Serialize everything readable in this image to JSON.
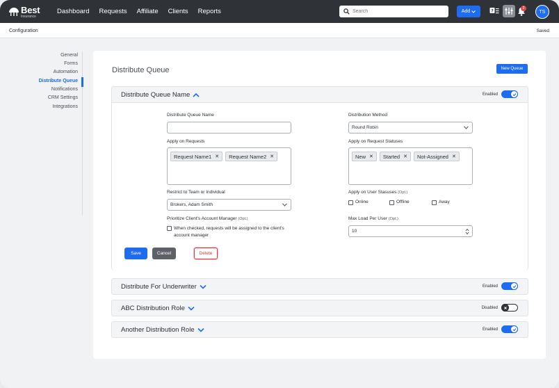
{
  "app": {
    "logo_name": "Best",
    "logo_sub": "Insurance",
    "nav": [
      "Dashboard",
      "Requests",
      "Affiliate",
      "Clients",
      "Reports"
    ],
    "search_placeholder": "Search",
    "add_label": "Add",
    "notification_count": "2",
    "avatar_initials": "TS"
  },
  "subbar": {
    "breadcrumb": "Configuration",
    "status": "Saved"
  },
  "sidenav": {
    "items": [
      "General",
      "Forms",
      "Automation",
      "Distribute Queue",
      "Notifications",
      "CRM Settings",
      "Integrations"
    ],
    "active": "Distribute Queue"
  },
  "main": {
    "title": "Distribute Queue",
    "new_queue_label": "New Queue",
    "sections": [
      {
        "title": "Distribute Queue Name",
        "expanded": true,
        "status": "Enabled",
        "enabled": true
      },
      {
        "title": "Distribute For Underwriter",
        "expanded": false,
        "status": "Enabled",
        "enabled": true
      },
      {
        "title": "ABC Distribution Role",
        "expanded": false,
        "status": "Disabled",
        "enabled": false
      },
      {
        "title": "Another Distribution Role",
        "expanded": false,
        "status": "Enabled",
        "enabled": true
      }
    ]
  },
  "form": {
    "queue_name_label": "Distribute Queue Name",
    "queue_name_value": "",
    "apply_requests_label": "Apply on Requests",
    "requests": [
      "Request Name1",
      "Request Name2"
    ],
    "restrict_label": "Restrict to Team or Individual",
    "restrict_value": "Brokers, Adam Smith",
    "prioritize_label": "Prioritize Client's Account Manager",
    "opt_tag": "(Opt.)",
    "prioritize_check": "When checked, requests will be assigned to the client's account manager",
    "method_label": "Distribution Method",
    "method_value": "Round Robin",
    "apply_statuses_label": "Apply on Request Statuses",
    "statuses": [
      "New",
      "Started",
      "Not-Assigned"
    ],
    "user_statuses_label": "Apply on User Stasuses",
    "user_statuses": [
      "Online",
      "Offline",
      "Away"
    ],
    "max_load_label": "Max Load Per User",
    "max_load_value": "10",
    "save_label": "Save",
    "cancel_label": "Cancel",
    "delete_label": "Delete"
  },
  "colors": {
    "accent": "#1e6cf0",
    "topbar": "#2f3237",
    "danger": "#e03b3b"
  }
}
